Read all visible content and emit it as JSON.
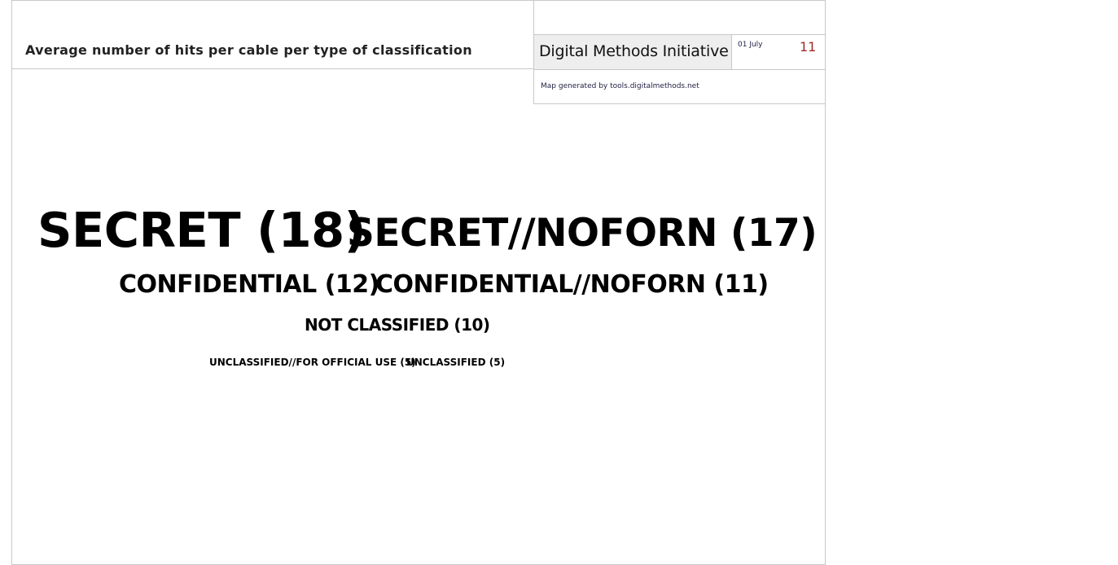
{
  "header": {
    "title": "Average number of hits per cable per type of classification"
  },
  "info": {
    "brand": "Digital Methods Initiative",
    "date": "01 July",
    "year": "11",
    "credit": "Map generated by tools.digitalmethods.net"
  },
  "tags": [
    {
      "label": "SECRET (18)",
      "weight": 18
    },
    {
      "label": "SECRET//NOFORN (17)",
      "weight": 17
    },
    {
      "label": "CONFIDENTIAL (12)",
      "weight": 12
    },
    {
      "label": "CONFIDENTIAL//NOFORN (11)",
      "weight": 11
    },
    {
      "label": "NOT CLASSIFIED (10)",
      "weight": 10
    },
    {
      "label": "UNCLASSIFIED//FOR OFFICIAL USE (5)",
      "weight": 5
    },
    {
      "label": "UNCLASSIFIED (5)",
      "weight": 5
    }
  ],
  "colors": {
    "year": "#a52a2a",
    "border": "#c8c8c8",
    "brand_bg": "#eeeeee"
  }
}
